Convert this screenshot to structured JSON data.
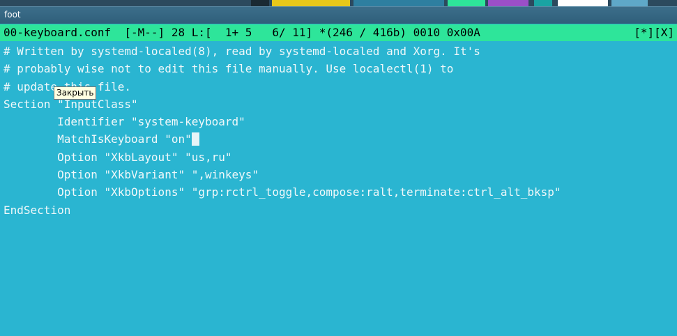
{
  "window": {
    "title": "foot"
  },
  "taskbar_colors": [
    "#1e6f8a",
    "#e8c81a",
    "#2e7fa0",
    "#2ee59a",
    "#9b4fc8",
    "#1aa3a3",
    "#ffffff",
    "#5fa8c8"
  ],
  "modeline": {
    "left": "00-keyboard.conf  [-M--] 28 L:[  1+ 5   6/ 11] *(246 / 416b) 0010 0x00A",
    "right": "[*][X]"
  },
  "editor": {
    "lines": [
      "# Written by systemd-localed(8), read by systemd-localed and Xorg. It's",
      "# probably wise not to edit this file manually. Use localectl(1) to",
      "# update this file.",
      "Section \"InputClass\"",
      "        Identifier \"system-keyboard\"",
      "        MatchIsKeyboard \"on\"",
      "        Option \"XkbLayout\" \"us,ru\"",
      "        Option \"XkbVariant\" \",winkeys\"",
      "        Option \"XkbOptions\" \"grp:rctrl_toggle,compose:ralt,terminate:ctrl_alt_bksp\"",
      "EndSection"
    ]
  },
  "tooltip": {
    "text": "Закрыть"
  },
  "colors": {
    "background": "#2ab5d1",
    "modeline": "#2ee59a",
    "text": "#f0f8fa"
  }
}
